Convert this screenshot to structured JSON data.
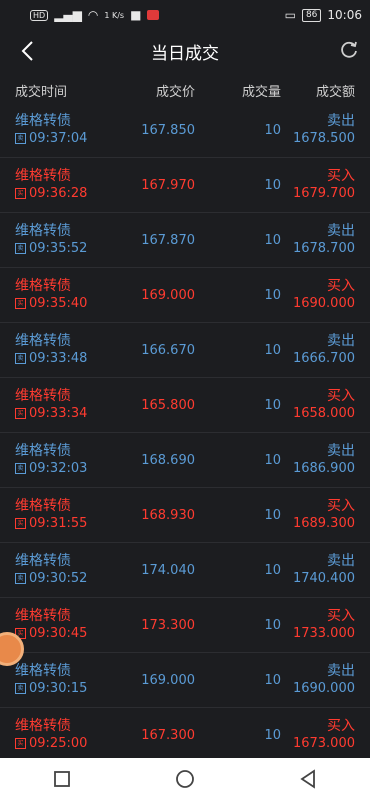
{
  "status": {
    "network_speed": "1 K/s",
    "battery": "86",
    "time": "10:06"
  },
  "header": {
    "title": "当日成交"
  },
  "columns": {
    "time": "成交时间",
    "price": "成交价",
    "qty": "成交量",
    "amount": "成交额"
  },
  "trades": [
    {
      "name": "维格转债",
      "type_tag": "卖",
      "time": "09:37:04",
      "price": "167.850",
      "qty": "10",
      "side": "卖出",
      "amount": "1678.500",
      "kind": "sell"
    },
    {
      "name": "维格转债",
      "type_tag": "买",
      "time": "09:36:28",
      "price": "167.970",
      "qty": "10",
      "side": "买入",
      "amount": "1679.700",
      "kind": "buy"
    },
    {
      "name": "维格转债",
      "type_tag": "卖",
      "time": "09:35:52",
      "price": "167.870",
      "qty": "10",
      "side": "卖出",
      "amount": "1678.700",
      "kind": "sell"
    },
    {
      "name": "维格转债",
      "type_tag": "买",
      "time": "09:35:40",
      "price": "169.000",
      "qty": "10",
      "side": "买入",
      "amount": "1690.000",
      "kind": "buy"
    },
    {
      "name": "维格转债",
      "type_tag": "卖",
      "time": "09:33:48",
      "price": "166.670",
      "qty": "10",
      "side": "卖出",
      "amount": "1666.700",
      "kind": "sell"
    },
    {
      "name": "维格转债",
      "type_tag": "买",
      "time": "09:33:34",
      "price": "165.800",
      "qty": "10",
      "side": "买入",
      "amount": "1658.000",
      "kind": "buy"
    },
    {
      "name": "维格转债",
      "type_tag": "卖",
      "time": "09:32:03",
      "price": "168.690",
      "qty": "10",
      "side": "卖出",
      "amount": "1686.900",
      "kind": "sell"
    },
    {
      "name": "维格转债",
      "type_tag": "买",
      "time": "09:31:55",
      "price": "168.930",
      "qty": "10",
      "side": "买入",
      "amount": "1689.300",
      "kind": "buy"
    },
    {
      "name": "维格转债",
      "type_tag": "卖",
      "time": "09:30:52",
      "price": "174.040",
      "qty": "10",
      "side": "卖出",
      "amount": "1740.400",
      "kind": "sell"
    },
    {
      "name": "维格转债",
      "type_tag": "买",
      "time": "09:30:45",
      "price": "173.300",
      "qty": "10",
      "side": "买入",
      "amount": "1733.000",
      "kind": "buy"
    },
    {
      "name": "维格转债",
      "type_tag": "卖",
      "time": "09:30:15",
      "price": "169.000",
      "qty": "10",
      "side": "卖出",
      "amount": "1690.000",
      "kind": "sell"
    },
    {
      "name": "维格转债",
      "type_tag": "买",
      "time": "09:25:00",
      "price": "167.300",
      "qty": "10",
      "side": "买入",
      "amount": "1673.000",
      "kind": "buy"
    }
  ],
  "colors": {
    "buy": "#ff3b30",
    "sell": "#5b9bd5",
    "background": "#1c1d20"
  }
}
